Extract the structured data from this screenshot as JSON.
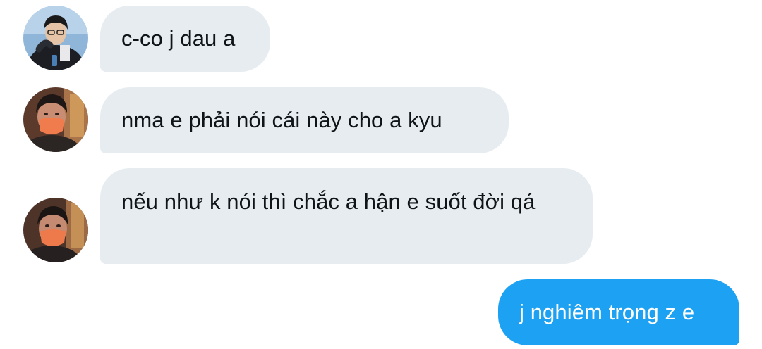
{
  "messages": [
    {
      "side": "incoming",
      "avatar": "avatar-icon",
      "text": "c-co j dau a"
    },
    {
      "side": "incoming",
      "avatar": "avatar-icon",
      "text": "nma e phải nói cái này cho a kyu"
    },
    {
      "side": "incoming",
      "avatar": "avatar-icon",
      "text": "nếu như k nói thì chắc a hận e suốt đời qá"
    },
    {
      "side": "outgoing",
      "text": "j nghiêm trọng z e"
    }
  ],
  "colors": {
    "incoming_bubble": "#e6ecf0",
    "outgoing_bubble": "#1da1f2",
    "text_dark": "#0f1419",
    "text_light": "#ffffff"
  }
}
